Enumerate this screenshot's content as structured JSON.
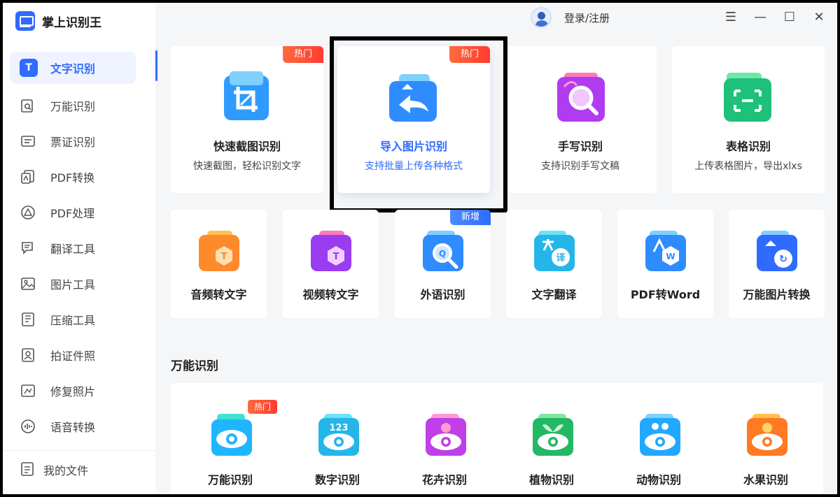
{
  "app": {
    "name": "掌上识别王"
  },
  "sidebar": {
    "items": [
      {
        "label": "文字识别",
        "icon": "text-recognition-icon",
        "active": true
      },
      {
        "label": "万能识别",
        "icon": "universal-scan-icon"
      },
      {
        "label": "票证识别",
        "icon": "ticket-icon"
      },
      {
        "label": "PDF转换",
        "icon": "pdf-convert-icon"
      },
      {
        "label": "PDF处理",
        "icon": "pdf-process-icon"
      },
      {
        "label": "翻译工具",
        "icon": "translate-icon"
      },
      {
        "label": "图片工具",
        "icon": "image-tool-icon"
      },
      {
        "label": "压缩工具",
        "icon": "compress-icon"
      },
      {
        "label": "拍证件照",
        "icon": "id-photo-icon"
      },
      {
        "label": "修复照片",
        "icon": "repair-photo-icon"
      },
      {
        "label": "语音转换",
        "icon": "voice-icon"
      }
    ],
    "active_icon_text": "T",
    "my_files": "我的文件"
  },
  "topbar": {
    "login": "登录/注册",
    "controls": {
      "menu": "☰",
      "minimize": "—",
      "maximize": "☐",
      "close": "✕"
    }
  },
  "big_cards": [
    {
      "title": "快速截图识别",
      "desc": "快速截图，轻松识别文字",
      "badge": "热门",
      "icon": "screenshot-crop-icon"
    },
    {
      "title": "导入图片识别",
      "desc": "支持批量上传各种格式",
      "badge": "热门",
      "icon": "import-image-icon",
      "selected": true
    },
    {
      "title": "手写识别",
      "desc": "支持识别手写文稿",
      "icon": "handwriting-icon"
    },
    {
      "title": "表格识别",
      "desc": "上传表格图片，导出xlxs",
      "icon": "table-scan-icon"
    }
  ],
  "small_cards": [
    {
      "title": "音频转文字",
      "icon": "audio-to-text-icon"
    },
    {
      "title": "视频转文字",
      "icon": "video-to-text-icon"
    },
    {
      "title": "外语识别",
      "badge": "新增",
      "icon": "foreign-language-icon"
    },
    {
      "title": "文字翻译",
      "icon": "text-translate-icon"
    },
    {
      "title": "PDF转Word",
      "icon": "pdf-to-word-icon"
    },
    {
      "title": "万能图片转换",
      "icon": "image-convert-icon"
    }
  ],
  "section": {
    "title": "万能识别",
    "items": [
      {
        "title": "万能识别",
        "badge": "热门",
        "icon": "universal-eye-icon"
      },
      {
        "title": "数字识别",
        "icon": "number-eye-icon"
      },
      {
        "title": "花卉识别",
        "icon": "flower-eye-icon"
      },
      {
        "title": "植物识别",
        "icon": "plant-eye-icon"
      },
      {
        "title": "动物识别",
        "icon": "animal-eye-icon"
      },
      {
        "title": "水果识别",
        "icon": "fruit-eye-icon"
      }
    ]
  },
  "glyphs": {
    "small_icon_letters": [
      "T",
      "T",
      "Q",
      "译",
      "W",
      "↻"
    ],
    "number_glyph": "123"
  },
  "colors": {
    "accent": "#2f6bff",
    "hot_badge": "#ff3b2f",
    "new_badge": "#2f6bff",
    "background": "#f5f6f8"
  }
}
